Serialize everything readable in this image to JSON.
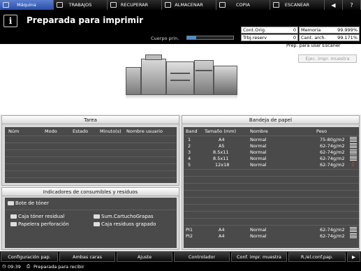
{
  "tabs": [
    {
      "label": "Máquina",
      "active": true
    },
    {
      "label": "TRABAJOS",
      "active": false
    },
    {
      "label": "RECUPERAR",
      "active": false
    },
    {
      "label": "ALMACENAR",
      "active": false
    },
    {
      "label": "COPIA",
      "active": false
    },
    {
      "label": "ESCANEAR",
      "active": false
    }
  ],
  "header": {
    "status_title": "Preparada para imprimir",
    "body_label": "Cuerpo prin.",
    "body_level": 0.2,
    "counters": {
      "cont_orig_label": "Cont.Orig.",
      "cont_orig_value": "0",
      "memoria_label": "Memoria",
      "memoria_value": "99.999%",
      "trbj_reserv_label": "Trbj.reserv",
      "trbj_reserv_value": "0",
      "cant_arch_label": "Cant. arch.",
      "cant_arch_value": "99.171%"
    }
  },
  "scanner_ready": "Prep. para usar Escáner",
  "ejec_button": "Ejec. impr. muestra",
  "tarea": {
    "title": "Tarea",
    "columns": [
      "Núm",
      "Modo",
      "Estado",
      "Minuto(s)",
      "Nombre usuario"
    ]
  },
  "consumibles": {
    "title": "Indicadores de consumibles y residuos",
    "items": [
      "Bote de tóner",
      "Caja tóner residual",
      "Sum.CartuchoGrapas",
      "Papelera perforación",
      "Caja residuos grapado"
    ]
  },
  "bandeja": {
    "title": "Bandeja de papel",
    "columns": [
      "Band",
      "Tamaño (mm)",
      "Nombre",
      "Peso"
    ],
    "rows": [
      {
        "band": "1",
        "size": "A4",
        "name": "Normal",
        "weight": "75-80g/m2"
      },
      {
        "band": "2",
        "size": "A5",
        "name": "Normal",
        "weight": "62-74g/m2"
      },
      {
        "band": "3",
        "size": "8.5x11",
        "name": "Normal",
        "weight": "62-74g/m2"
      },
      {
        "band": "4",
        "size": "8.5x11",
        "name": "Normal",
        "weight": "62-74g/m2"
      },
      {
        "band": "5",
        "size": "12x18",
        "name": "Normal",
        "weight": "62-74g/m2"
      }
    ],
    "pi_rows": [
      {
        "band": "PI1",
        "size": "A4",
        "name": "Normal",
        "weight": "62-74g/m2"
      },
      {
        "band": "PI2",
        "size": "A4",
        "name": "Normal",
        "weight": "62-74g/m2"
      }
    ]
  },
  "bottom_buttons": [
    "Configuración pap.",
    "Ambas caras",
    "Ajuste",
    "Controlador",
    "Conf. impr. muestra",
    "R./el.conf.pap."
  ],
  "footer": {
    "time": "09:39",
    "status": "Preparada para recibir"
  },
  "colors": {
    "accent_tab": "#3a62be",
    "alert": "#e84a1a"
  }
}
